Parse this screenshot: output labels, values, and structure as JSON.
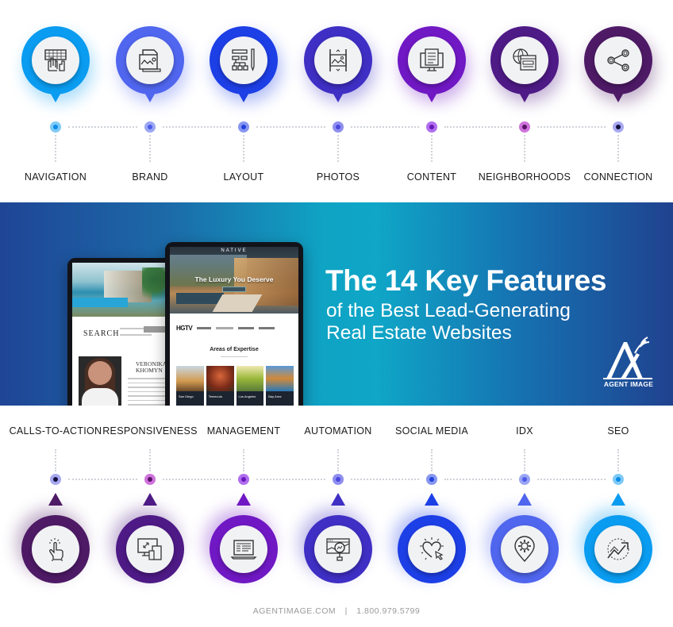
{
  "top_features": [
    {
      "label": "NAVIGATION",
      "icon": "touch-keyboard-icon",
      "color": "#0a9cf0",
      "dot_outer": "#7fcaf6",
      "dot_inner": "#0a8be8"
    },
    {
      "label": "BRAND",
      "icon": "brand-portfolio-icon",
      "color": "#5066ee",
      "dot_outer": "#9aa6f4",
      "dot_inner": "#4d5be8"
    },
    {
      "label": "LAYOUT",
      "icon": "sitemap-layout-icon",
      "color": "#1d3fe6",
      "dot_outer": "#8797ef",
      "dot_inner": "#2142dd"
    },
    {
      "label": "PHOTOS",
      "icon": "photo-slider-icon",
      "color": "#3f2fc4",
      "dot_outer": "#8f8ef0",
      "dot_inner": "#4b48dc"
    },
    {
      "label": "CONTENT",
      "icon": "content-monitor-icon",
      "color": "#7018c4",
      "dot_outer": "#b06ef0",
      "dot_inner": "#6a18b8"
    },
    {
      "label": "NEIGHBORHOODS",
      "icon": "globe-browser-icon",
      "color": "#4e1a86",
      "dot_outer": "#cf72dc",
      "dot_inner": "#5a1466"
    },
    {
      "label": "CONNECTION",
      "icon": "share-network-icon",
      "color": "#4e1a66",
      "dot_outer": "#a7a8f0",
      "dot_inner": "#14103e"
    }
  ],
  "banner": {
    "title": "The 14 Key Features",
    "subtitle_line1": "of the Best Lead-Generating",
    "subtitle_line2": "Real Estate Websites",
    "logo_text": "AGENT IMAGE",
    "mockup": {
      "back_site_heading": "SEARCH",
      "back_agent_name": "VERONIKA KHOMYN",
      "front_site_brand": "NATIVE",
      "front_hero_title": "The Luxury You Deserve",
      "front_press_logo": "HGTV",
      "front_section_title": "Areas of Expertise",
      "front_cards": [
        "San Diego",
        "Temecula",
        "Los Angeles",
        "Bay Area"
      ]
    }
  },
  "bottom_features": [
    {
      "label": "CALLS-TO-ACTION",
      "icon": "tap-finger-icon",
      "color": "#4e1a66",
      "dot_outer": "#a7a8f0",
      "dot_inner": "#14103e"
    },
    {
      "label": "RESPONSIVENESS",
      "icon": "responsive-devices-icon",
      "color": "#4e1a86",
      "dot_outer": "#cf72dc",
      "dot_inner": "#5a1466"
    },
    {
      "label": "MANAGEMENT",
      "icon": "laptop-cms-icon",
      "color": "#7018c4",
      "dot_outer": "#b06ef0",
      "dot_inner": "#6a18b8"
    },
    {
      "label": "AUTOMATION",
      "icon": "analytics-magnifier-icon",
      "color": "#3f2fc4",
      "dot_outer": "#8f8ef0",
      "dot_inner": "#4b48dc"
    },
    {
      "label": "SOCIAL MEDIA",
      "icon": "heart-click-icon",
      "color": "#1d3fe6",
      "dot_outer": "#8797ef",
      "dot_inner": "#2142dd"
    },
    {
      "label": "IDX",
      "icon": "location-gear-icon",
      "color": "#5066ee",
      "dot_outer": "#9aa6f4",
      "dot_inner": "#4d5be8"
    },
    {
      "label": "SEO",
      "icon": "growth-chart-icon",
      "color": "#0a9cf0",
      "dot_outer": "#7fcaf6",
      "dot_inner": "#0a8be8"
    }
  ],
  "footer": {
    "website": "AGENTIMAGE.COM",
    "separator": "|",
    "phone": "1.800.979.5799"
  }
}
